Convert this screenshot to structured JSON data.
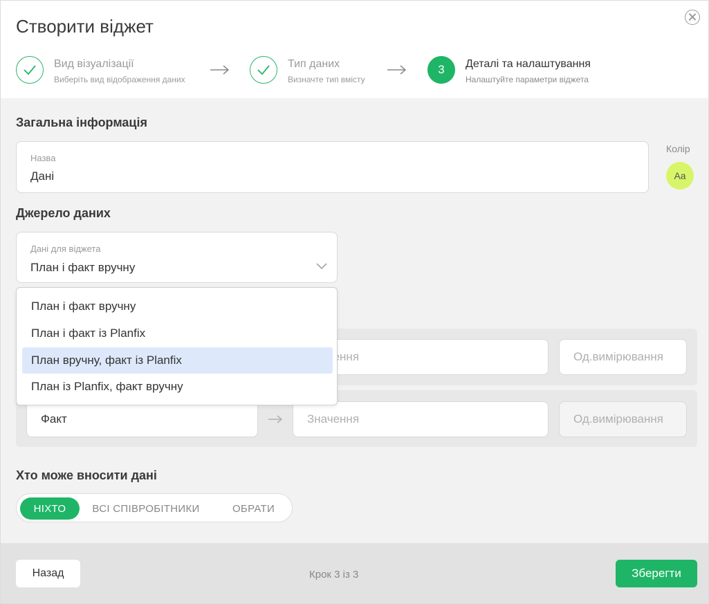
{
  "dialog": {
    "title": "Створити віджет"
  },
  "steps": [
    {
      "number": "",
      "title": "Вид візуалізації",
      "subtitle": "Виберіть вид відображення даних",
      "state": "done"
    },
    {
      "number": "",
      "title": "Тип даних",
      "subtitle": "Визначте тип вмісту",
      "state": "done"
    },
    {
      "number": "3",
      "title": "Деталі та налаштування",
      "subtitle": "Налаштуйте параметри віджета",
      "state": "current"
    }
  ],
  "general": {
    "heading": "Загальна інформація",
    "name_label": "Назва",
    "name_value": "Дані",
    "color_label": "Колір",
    "color_swatch_text": "Aa",
    "color_value": "#d8f56a"
  },
  "source": {
    "heading": "Джерело даних",
    "select_label": "Дані для віджета",
    "select_value": "План і факт вручну",
    "options": [
      "План і факт вручну",
      "План і факт із Planfix",
      "План вручну, факт із Planfix",
      "План із Planfix, факт вручну"
    ],
    "highlighted_option": "План вручну, факт із Planfix"
  },
  "rows": [
    {
      "name": "",
      "value_placeholder": "Значення",
      "unit_placeholder": "Од.вимірювання"
    },
    {
      "name": "Факт",
      "value_placeholder": "Значення",
      "unit_placeholder": "Од.вимірювання"
    }
  ],
  "access": {
    "heading": "Хто може вносити дані",
    "options": [
      "НІХТО",
      "ВСІ СПІВРОБІТНИКИ",
      "ОБРАТИ"
    ],
    "selected": "НІХТО"
  },
  "footer": {
    "back_label": "Назад",
    "step_text": "Крок 3 із 3",
    "save_label": "Зберегти"
  },
  "colors": {
    "accent": "#1fb566",
    "highlight": "#dde9fb"
  }
}
